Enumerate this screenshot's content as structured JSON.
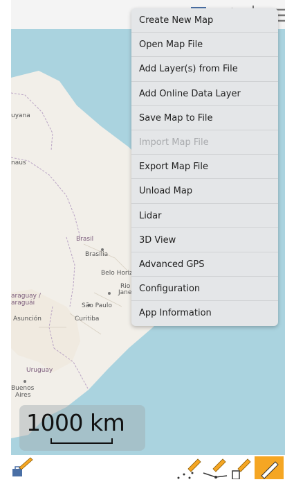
{
  "map": {
    "labels": {
      "guyana": "uyana",
      "manaus": "naus",
      "brasil": "Brasil",
      "brasilia": "Brasília",
      "belo_horizonte": "Belo Horiz",
      "rio": "Rio",
      "rio_jane": "Jane",
      "paraguay": "araguay /",
      "paraguai": "araguái",
      "sao_paulo": "São Paulo",
      "asuncion": "Asunción",
      "curitiba": "Curitiba",
      "uruguay": "Uruguay",
      "buenos": "Buenos",
      "aires": "Aires"
    },
    "colors": {
      "water": "#aad3df",
      "land": "#f2efe9",
      "border": "#b9a3c4"
    }
  },
  "scale_bar": {
    "label": "1000 km"
  },
  "menu": {
    "items": [
      {
        "label": "Create New Map",
        "enabled": true
      },
      {
        "label": "Open Map File",
        "enabled": true
      },
      {
        "label": "Add Layer(s) from File",
        "enabled": true
      },
      {
        "label": "Add Online Data Layer",
        "enabled": true
      },
      {
        "label": "Save Map to File",
        "enabled": true
      },
      {
        "label": "Import Map File",
        "enabled": false
      },
      {
        "label": "Export Map File",
        "enabled": true
      },
      {
        "label": "Unload Map",
        "enabled": true
      },
      {
        "label": "Lidar",
        "enabled": true
      },
      {
        "label": "3D View",
        "enabled": true
      },
      {
        "label": "Advanced GPS",
        "enabled": true
      },
      {
        "label": "Configuration",
        "enabled": true
      },
      {
        "label": "App Information",
        "enabled": true
      }
    ]
  },
  "toolbar": {
    "top_icons": [
      "layers-icon",
      "navigate-icon",
      "gps-target-icon",
      "hamburger-menu-icon"
    ],
    "bottom_left_icons": [
      "briefcase-pencil-icon"
    ],
    "bottom_right_icons": [
      "draw-points-icon",
      "draw-line-icon",
      "draw-polygon-icon",
      "edit-pencil-icon"
    ],
    "accent_color": "#f5a623"
  }
}
